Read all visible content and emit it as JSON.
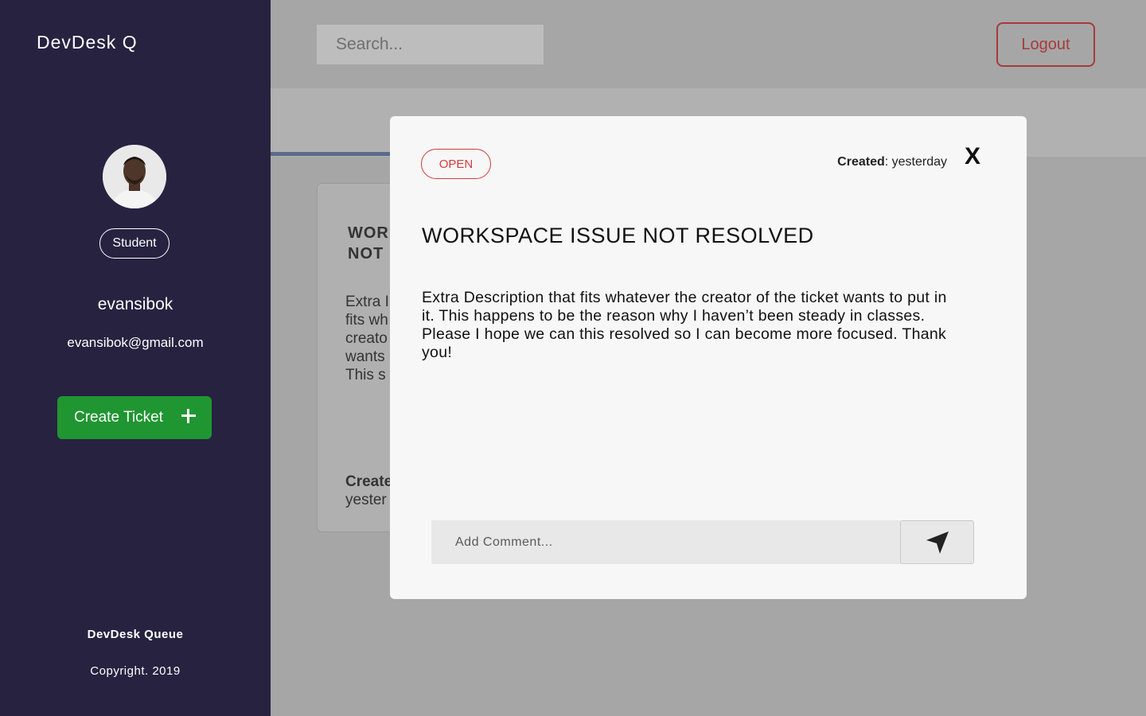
{
  "sidebar": {
    "brand": "DevDesk Q",
    "role": "Student",
    "username": "evansibok",
    "email": "evansibok@gmail.com",
    "create_ticket_label": "Create Ticket",
    "footer_title": "DevDesk Queue",
    "footer_copyright": "Copyright. 2019"
  },
  "header": {
    "search_placeholder": "Search...",
    "logout_label": "Logout"
  },
  "background_card": {
    "title": "WORK\nNOT I",
    "description": "Extra I\nfits wh\ncreato\nwants\nThis s",
    "created_label": "Create",
    "created_value": "yester"
  },
  "modal": {
    "status": "OPEN",
    "created_label": "Created",
    "created_value": ": yesterday",
    "close_label": "X",
    "title": "WORKSPACE ISSUE NOT RESOLVED",
    "description": "Extra Description that fits whatever the creator of the ticket wants to put in it. This happens to be the reason why I haven’t been steady in classes. Please I hope we can this resolved so I can become more focused. Thank you!",
    "comment_placeholder": "Add Comment...",
    "send_icon": "send-arrow-icon"
  },
  "colors": {
    "sidebar_bg": "#262240",
    "create_button": "#1f9631",
    "status_red": "#d33b3b",
    "logout_red": "#a83a3a",
    "overlay_bg": "#a6a6a6"
  }
}
